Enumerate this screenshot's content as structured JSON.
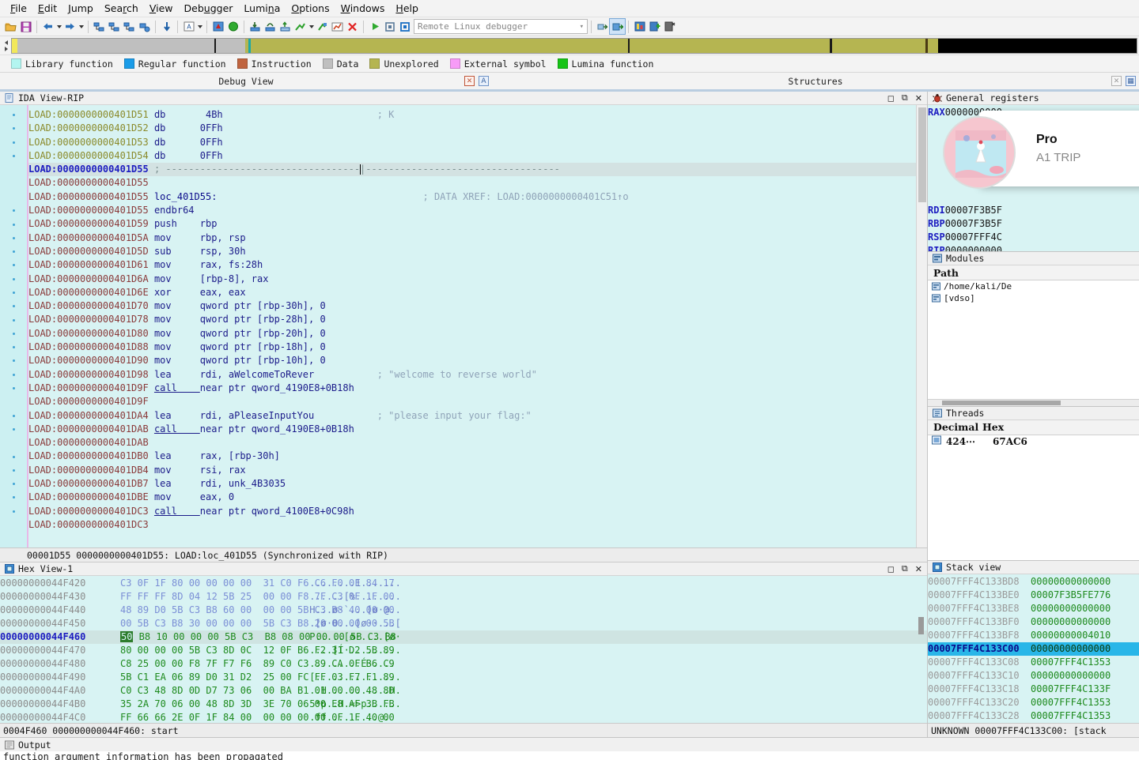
{
  "menu": {
    "items": [
      "File",
      "Edit",
      "Jump",
      "Search",
      "View",
      "Debugger",
      "Lumina",
      "Options",
      "Windows",
      "Help"
    ]
  },
  "toolbar": {
    "debugger_value": "Remote Linux debugger",
    "icons": [
      "open-folder-icon",
      "save-icon",
      "back-arrow-icon",
      "back-dropdown-icon",
      "forward-arrow-icon",
      "forward-dropdown-icon",
      "graph-icon-1",
      "graph-icon-2",
      "graph-icon-3",
      "graph-icon-4",
      "step-down-icon",
      "text-mode-icon",
      "text-mode-dropdown-icon",
      "breakpoint-icon",
      "run-to-icon",
      "step-into-icon",
      "step-over-icon",
      "step-out-icon",
      "trace-icon",
      "trace-dropdown-icon",
      "run-icon",
      "chart-icon",
      "stop-icon",
      "play-icon",
      "pause-icon",
      "stop-square-icon",
      "attach-icon",
      "detach-icon",
      "struct-icon-1",
      "struct-icon-2",
      "struct-icon-3"
    ]
  },
  "legend": {
    "items": [
      {
        "label": "Library function",
        "color": "#b3f5f0"
      },
      {
        "label": "Regular function",
        "color": "#1a9ce8"
      },
      {
        "label": "Instruction",
        "color": "#c0643f"
      },
      {
        "label": "Data",
        "color": "#bfbfbf"
      },
      {
        "label": "Unexplored",
        "color": "#b5b551"
      },
      {
        "label": "External symbol",
        "color": "#f79bf7"
      },
      {
        "label": "Lumina function",
        "color": "#17c417"
      }
    ]
  },
  "navband": {
    "segments": [
      {
        "color": "#f2e85a",
        "width": "0.5%"
      },
      {
        "color": "#bfbfbf",
        "width": "17.5%"
      },
      {
        "color": "#1a1a1a",
        "width": "0.15%"
      },
      {
        "color": "#bfbfbf",
        "width": "2.6%"
      },
      {
        "color": "#b5b551",
        "width": "0.3%"
      },
      {
        "color": "#1ba8a8",
        "width": "0.2%"
      },
      {
        "color": "#b5b551",
        "width": "33.5%"
      },
      {
        "color": "#1a1a1a",
        "width": "0.2%"
      },
      {
        "color": "#b5b551",
        "width": "17.8%"
      },
      {
        "color": "#1a1a1a",
        "width": "0.2%"
      },
      {
        "color": "#b5b551",
        "width": "8.3%"
      },
      {
        "color": "#4a3a14",
        "width": "0.2%"
      },
      {
        "color": "#b5b551",
        "width": "0.9%"
      },
      {
        "color": "#000000",
        "width": "17.65%"
      }
    ]
  },
  "tabs": {
    "left": {
      "title": "Debug View"
    },
    "right": {
      "title": "Structures"
    }
  },
  "disasm": {
    "panel_title": "IDA View-RIP",
    "status": "00001D55 0000000000401D55: LOAD:loc_401D55 (Synchronized with RIP)",
    "lines": [
      {
        "dot": true,
        "seg": "LOAD:00000000",
        "addr": "00401D51",
        "kind": "olive",
        "mnem": "db",
        "ops": " 4Bh",
        "cmt": "; K",
        "sel": false
      },
      {
        "dot": true,
        "seg": "LOAD:00000000",
        "addr": "00401D52",
        "kind": "olive",
        "mnem": "db",
        "ops": "0FFh",
        "cmt": "",
        "sel": false
      },
      {
        "dot": true,
        "seg": "LOAD:00000000",
        "addr": "00401D53",
        "kind": "olive",
        "mnem": "db",
        "ops": "0FFh",
        "cmt": "",
        "sel": false
      },
      {
        "dot": true,
        "seg": "LOAD:00000000",
        "addr": "00401D54",
        "kind": "olive",
        "mnem": "db",
        "ops": "0FFh",
        "cmt": "",
        "sel": false
      },
      {
        "dot": false,
        "seg": "LOAD:00000000",
        "addr": "00401D55",
        "kind": "blue",
        "mnem": "",
        "ops": "",
        "cmt": "",
        "sel": true,
        "divider": true
      },
      {
        "dot": false,
        "seg": "LOAD:00000000",
        "addr": "00401D55",
        "kind": "red",
        "mnem": "",
        "ops": "",
        "cmt": "",
        "sel": false
      },
      {
        "dot": false,
        "seg": "LOAD:00000000",
        "addr": "00401D55",
        "kind": "red",
        "mnem": "",
        "label": "loc_401D55:",
        "ops": "",
        "cmt": "; DATA XREF: LOAD:0000000000401C51↑o",
        "sel": false
      },
      {
        "dot": true,
        "seg": "LOAD:00000000",
        "addr": "00401D55",
        "kind": "red",
        "mnem": "endbr64",
        "ops": "",
        "cmt": "",
        "sel": false
      },
      {
        "dot": true,
        "seg": "LOAD:00000000",
        "addr": "00401D59",
        "kind": "red",
        "mnem": "push",
        "ops": "rbp",
        "cmt": "",
        "sel": false
      },
      {
        "dot": true,
        "seg": "LOAD:00000000",
        "addr": "00401D5A",
        "kind": "red",
        "mnem": "mov",
        "ops": "rbp, rsp",
        "cmt": "",
        "sel": false
      },
      {
        "dot": true,
        "seg": "LOAD:00000000",
        "addr": "00401D5D",
        "kind": "red",
        "mnem": "sub",
        "ops": "rsp, 30h",
        "cmt": "",
        "sel": false
      },
      {
        "dot": true,
        "seg": "LOAD:00000000",
        "addr": "00401D61",
        "kind": "red",
        "mnem": "mov",
        "ops": "rax, fs:28h",
        "cmt": "",
        "sel": false
      },
      {
        "dot": true,
        "seg": "LOAD:00000000",
        "addr": "00401D6A",
        "kind": "red",
        "mnem": "mov",
        "ops": "[rbp-8], rax",
        "cmt": "",
        "sel": false
      },
      {
        "dot": true,
        "seg": "LOAD:00000000",
        "addr": "00401D6E",
        "kind": "red",
        "mnem": "xor",
        "ops": "eax, eax",
        "cmt": "",
        "sel": false
      },
      {
        "dot": true,
        "seg": "LOAD:00000000",
        "addr": "00401D70",
        "kind": "red",
        "mnem": "mov",
        "ops": "qword ptr [rbp-30h], 0",
        "cmt": "",
        "sel": false
      },
      {
        "dot": true,
        "seg": "LOAD:00000000",
        "addr": "00401D78",
        "kind": "red",
        "mnem": "mov",
        "ops": "qword ptr [rbp-28h], 0",
        "cmt": "",
        "sel": false
      },
      {
        "dot": true,
        "seg": "LOAD:00000000",
        "addr": "00401D80",
        "kind": "red",
        "mnem": "mov",
        "ops": "qword ptr [rbp-20h], 0",
        "cmt": "",
        "sel": false
      },
      {
        "dot": true,
        "seg": "LOAD:00000000",
        "addr": "00401D88",
        "kind": "red",
        "mnem": "mov",
        "ops": "qword ptr [rbp-18h], 0",
        "cmt": "",
        "sel": false
      },
      {
        "dot": true,
        "seg": "LOAD:00000000",
        "addr": "00401D90",
        "kind": "red",
        "mnem": "mov",
        "ops": "qword ptr [rbp-10h], 0",
        "cmt": "",
        "sel": false
      },
      {
        "dot": true,
        "seg": "LOAD:00000000",
        "addr": "00401D98",
        "kind": "red",
        "mnem": "lea",
        "ops": "rdi, aWelcomeToRever",
        "cmt": "; \"welcome to reverse world\"",
        "sel": false
      },
      {
        "dot": true,
        "seg": "LOAD:00000000",
        "addr": "00401D9F",
        "kind": "red",
        "mnem": "call",
        "ops": "near ptr qword_4190E8+0B18h",
        "cmt": "",
        "sel": false,
        "underline_mnem": true
      },
      {
        "dot": false,
        "seg": "LOAD:00000000",
        "addr": "00401D9F",
        "kind": "red",
        "mnem": "",
        "ops": "",
        "cmt": "",
        "sel": false
      },
      {
        "dot": true,
        "seg": "LOAD:00000000",
        "addr": "00401DA4",
        "kind": "red",
        "mnem": "lea",
        "ops": "rdi, aPleaseInputYou",
        "cmt": "; \"please input your flag:\"",
        "sel": false
      },
      {
        "dot": true,
        "seg": "LOAD:00000000",
        "addr": "00401DAB",
        "kind": "red",
        "mnem": "call",
        "ops": "near ptr qword_4190E8+0B18h",
        "cmt": "",
        "sel": false,
        "underline_mnem": true
      },
      {
        "dot": false,
        "seg": "LOAD:00000000",
        "addr": "00401DAB",
        "kind": "red",
        "mnem": "",
        "ops": "",
        "cmt": "",
        "sel": false
      },
      {
        "dot": true,
        "seg": "LOAD:00000000",
        "addr": "00401DB0",
        "kind": "red",
        "mnem": "lea",
        "ops": "rax, [rbp-30h]",
        "cmt": "",
        "sel": false
      },
      {
        "dot": true,
        "seg": "LOAD:00000000",
        "addr": "00401DB4",
        "kind": "red",
        "mnem": "mov",
        "ops": "rsi, rax",
        "cmt": "",
        "sel": false
      },
      {
        "dot": true,
        "seg": "LOAD:00000000",
        "addr": "00401DB7",
        "kind": "red",
        "mnem": "lea",
        "ops": "rdi, unk_4B3035",
        "cmt": "",
        "sel": false
      },
      {
        "dot": true,
        "seg": "LOAD:00000000",
        "addr": "00401DBE",
        "kind": "red",
        "mnem": "mov",
        "ops": "eax, 0",
        "cmt": "",
        "sel": false
      },
      {
        "dot": true,
        "seg": "LOAD:00000000",
        "addr": "00401DC3",
        "kind": "red",
        "mnem": "call",
        "ops": "near ptr qword_4100E8+0C98h",
        "cmt": "",
        "sel": false,
        "underline_mnem": true
      },
      {
        "dot": false,
        "seg": "LOAD:00000000",
        "addr": "00401DC3",
        "kind": "red",
        "mnem": "",
        "ops": "",
        "cmt": "",
        "sel": false
      }
    ]
  },
  "hexview": {
    "panel_title": "Hex View-1",
    "status": "0004F460 000000000044F460: start",
    "rows": [
      {
        "addr": "00000000044F420",
        "bytes": "C3 0F 1F 80 00 00 00 00  31 C0 F6 C6 F0 0F 84 17",
        "ascii": "........1.......",
        "green": false,
        "sel": false
      },
      {
        "addr": "00000000044F430",
        "bytes": "FF FF FF 8D 04 12 5B 25  00 00 F8 7F C3 0F 1F 00",
        "ascii": "......[%........",
        "green": false,
        "sel": false
      },
      {
        "addr": "00000000044F440",
        "bytes": "48 89 D0 5B C3 B8 60 00  00 00 5B C3 B8 40 00 00",
        "ascii": "H...ø·`...[ø·@..",
        "green": false,
        "sel": false
      },
      {
        "addr": "00000000044F450",
        "bytes": "00 5B C3 B8 30 00 00 00  5B C3 B8 20 00 00 00 5B",
        "ascii": ".[ø·0...[ø··...[",
        "green": false,
        "sel": false
      },
      {
        "addr": "00000000044F460",
        "bytes": "50 B8 10 00 00 00 5B C3  B8 08 00 00 00 5B C3 B8",
        "ascii": "P.....[ø·....[ø·",
        "green": true,
        "sel": true,
        "first_byte_boxed": true
      },
      {
        "addr": "00000000044F470",
        "bytes": "80 00 00 00 5B C3 8D 0C  12 0F B6 F2 31 D2 5B 89",
        "ascii": "....[Í·.........",
        "green": true,
        "sel": false
      },
      {
        "addr": "00000000044F480",
        "bytes": "C8 25 00 00 F8 7F F7 F6  89 C0 C3 89 CA 0F B6 C9",
        "ascii": ".........É·....",
        "green": true,
        "sel": false
      },
      {
        "addr": "00000000044F490",
        "bytes": "5B C1 EA 06 89 D0 31 D2  25 00 FC FF 03 F7 F1 89",
        "ascii": "[...............",
        "green": true,
        "sel": false
      },
      {
        "addr": "00000000044F4A0",
        "bytes": "C0 C3 48 8D 0D D7 73 06  00 BA B1 01 00 00 48 8D",
        "ascii": "..H...........H.",
        "green": true,
        "sel": false
      },
      {
        "addr": "00000000044F4B0",
        "bytes": "35 2A 70 06 00 48 8D 3D  3E 70 06 00 E8 AF 3B FB",
        "ascii": "5*p..H.=>p......",
        "green": true,
        "sel": false
      },
      {
        "addr": "00000000044F4C0",
        "bytes": "FF 66 66 2E 0F 1F 84 00  00 00 00 00 0F 1F 40 00",
        "ascii": ".ff.........@.",
        "green": true,
        "sel": false
      }
    ]
  },
  "registers": {
    "panel_title": "General registers",
    "rows": [
      {
        "name": "RAX",
        "value": "0000000000"
      },
      {
        "name": "RDI",
        "value": "00007F3B5F"
      },
      {
        "name": "RBP",
        "value": "00007F3B5F"
      },
      {
        "name": "RSP",
        "value": "00007FFF4C"
      },
      {
        "name": "RIP",
        "value": "0000000000"
      }
    ]
  },
  "modules": {
    "panel_title": "Modules",
    "column_header": "Path",
    "rows": [
      "/home/kali/De",
      "[vdso]"
    ]
  },
  "threads": {
    "panel_title": "Threads",
    "columns": [
      "Decimal",
      "Hex"
    ],
    "rows": [
      {
        "decimal": "424⋯",
        "hex": "67AC6"
      }
    ]
  },
  "stackview": {
    "panel_title": "Stack view",
    "status": "UNKNOWN 00007FFF4C133C00: [stack",
    "rows": [
      {
        "addr": "00007FFF4C133BD8",
        "value": "00000000000000",
        "sel": false
      },
      {
        "addr": "00007FFF4C133BE0",
        "value": "00007F3B5FE776",
        "sel": false
      },
      {
        "addr": "00007FFF4C133BE8",
        "value": "00000000000000",
        "sel": false
      },
      {
        "addr": "00007FFF4C133BF0",
        "value": "00000000000000",
        "sel": false
      },
      {
        "addr": "00007FFF4C133BF8",
        "value": "00000000004010",
        "sel": false
      },
      {
        "addr": "00007FFF4C133C00",
        "value": "00000000000000",
        "sel": true
      },
      {
        "addr": "00007FFF4C133C08",
        "value": "00007FFF4C1353",
        "sel": false
      },
      {
        "addr": "00007FFF4C133C10",
        "value": "00000000000000",
        "sel": false
      },
      {
        "addr": "00007FFF4C133C18",
        "value": "00007FFF4C133F",
        "sel": false
      },
      {
        "addr": "00007FFF4C133C20",
        "value": "00007FFF4C1353",
        "sel": false
      },
      {
        "addr": "00007FFF4C133C28",
        "value": "00007FFF4C1353",
        "sel": false
      }
    ]
  },
  "output": {
    "panel_title": "Output",
    "line": "function argument information has been propagated"
  },
  "notification": {
    "title": "Pro",
    "subtitle": "A1 TRIP"
  }
}
